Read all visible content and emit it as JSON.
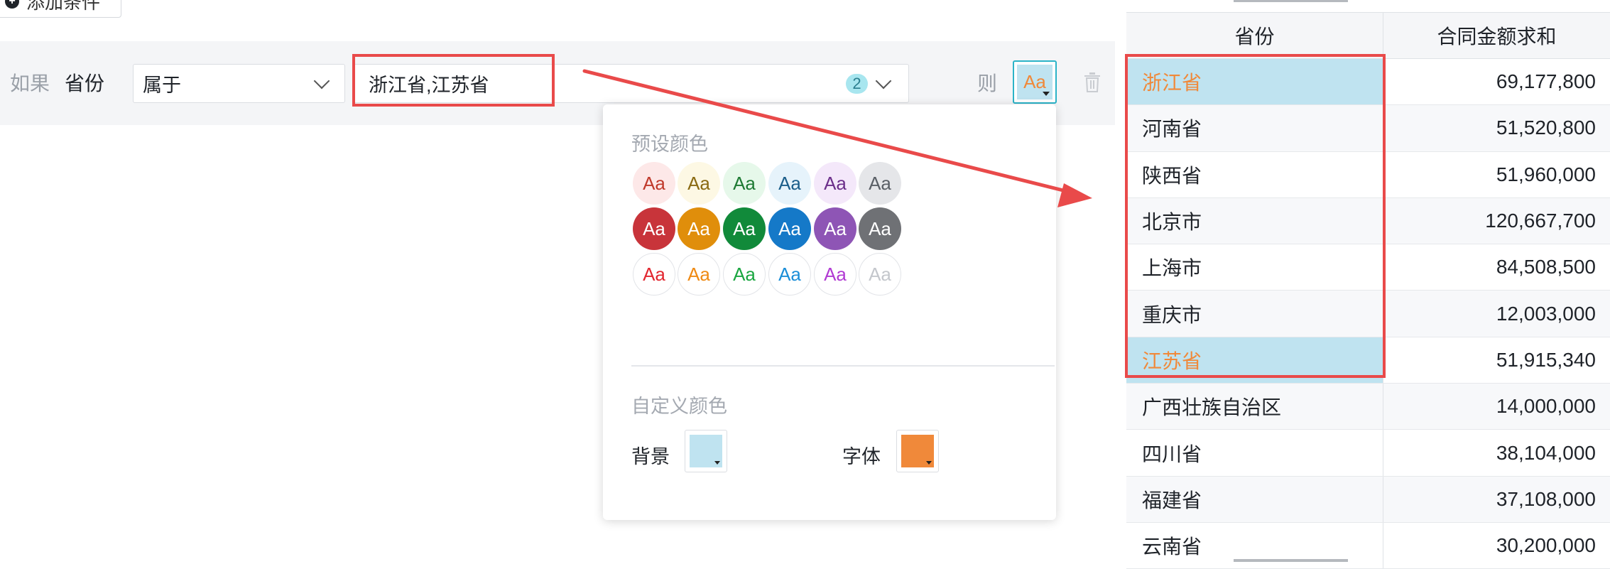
{
  "add_condition": {
    "label": "添加条件"
  },
  "condition": {
    "if_label": "如果",
    "field": "省份",
    "operator": "属于",
    "value": "浙江省,江苏省",
    "value_count": "2",
    "then_label": "则",
    "style_preview": "Aa"
  },
  "popover": {
    "preset_title": "预设颜色",
    "custom_title": "自定义颜色",
    "background_label": "背景",
    "font_label": "字体",
    "background_color": "#bfe3f0",
    "font_color": "#f0893a",
    "swatch_text": "Aa",
    "preset_rows": [
      [
        {
          "bg": "#fde8e8",
          "fg": "#c0392b"
        },
        {
          "bg": "#fdf8e4",
          "fg": "#8a6a12"
        },
        {
          "bg": "#e6f8ea",
          "fg": "#1d7a33"
        },
        {
          "bg": "#e6f3fb",
          "fg": "#1b5e8a"
        },
        {
          "bg": "#f4e8fa",
          "fg": "#6b2e8a"
        },
        {
          "bg": "#e5e6e9",
          "fg": "#5a5f66"
        }
      ],
      [
        {
          "bg": "#c8343a",
          "fg": "#ffffff"
        },
        {
          "bg": "#e08e0b",
          "fg": "#ffffff"
        },
        {
          "bg": "#118a3a",
          "fg": "#ffffff"
        },
        {
          "bg": "#1579c8",
          "fg": "#ffffff"
        },
        {
          "bg": "#8e55b5",
          "fg": "#ffffff"
        },
        {
          "bg": "#6f7175",
          "fg": "#ffffff"
        }
      ],
      [
        {
          "bg": "#ffffff",
          "fg": "#e2262f"
        },
        {
          "bg": "#ffffff",
          "fg": "#ef8a14"
        },
        {
          "bg": "#ffffff",
          "fg": "#1aa640"
        },
        {
          "bg": "#ffffff",
          "fg": "#1b8ed8"
        },
        {
          "bg": "#ffffff",
          "fg": "#b13ad3"
        },
        {
          "bg": "#ffffff",
          "fg": "#c4c7cc"
        }
      ]
    ]
  },
  "table": {
    "headers": [
      "省份",
      "合同金额求和"
    ],
    "rows": [
      {
        "province": "浙江省",
        "amount": "69,177,800",
        "highlight": true
      },
      {
        "province": "河南省",
        "amount": "51,520,800",
        "highlight": false
      },
      {
        "province": "陕西省",
        "amount": "51,960,000",
        "highlight": false
      },
      {
        "province": "北京市",
        "amount": "120,667,700",
        "highlight": false
      },
      {
        "province": "上海市",
        "amount": "84,508,500",
        "highlight": false
      },
      {
        "province": "重庆市",
        "amount": "12,003,000",
        "highlight": false
      },
      {
        "province": "江苏省",
        "amount": "51,915,340",
        "highlight": true
      },
      {
        "province": "广西壮族自治区",
        "amount": "14,000,000",
        "highlight": false
      },
      {
        "province": "四川省",
        "amount": "38,104,000",
        "highlight": false
      },
      {
        "province": "福建省",
        "amount": "37,108,000",
        "highlight": false
      },
      {
        "province": "云南省",
        "amount": "30,200,000",
        "highlight": false
      }
    ]
  },
  "colors": {
    "annotation_red": "#e94a4a",
    "accent_teal": "#2bb3c8"
  }
}
